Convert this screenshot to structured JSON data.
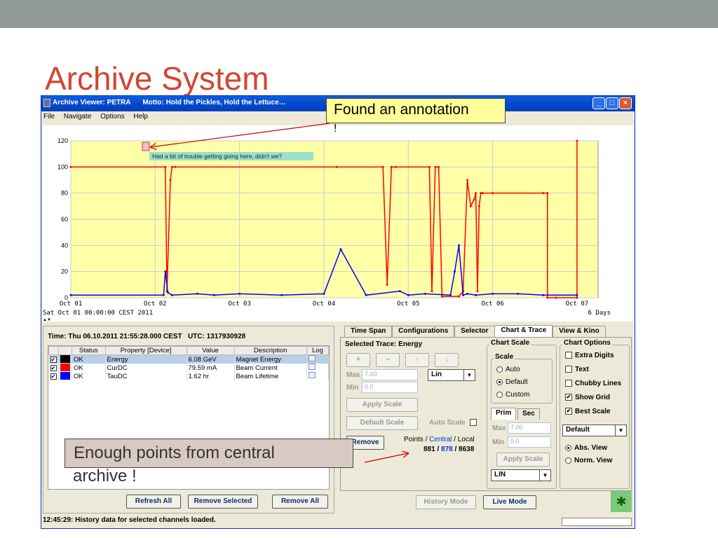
{
  "slide": {
    "title": "Archive System"
  },
  "window": {
    "title": "Archive Viewer: PETRA",
    "motto": "Motto: Hold the Pickles, Hold the Lettuce…",
    "menu": [
      "File",
      "Navigate",
      "Options",
      "Help"
    ]
  },
  "plot": {
    "annotation_marker": "i",
    "annotation_text": "Had a bit of trouble getting going here, didn't we?",
    "start_label": "Sat Oct 01 00:00:00 CEST 2011",
    "span_label": "6 Days",
    "collapse_glyph": "▲▼"
  },
  "chart_data": {
    "type": "line",
    "ylim": [
      0,
      120
    ],
    "yticks": [
      0,
      20,
      40,
      60,
      80,
      100,
      120
    ],
    "xticks": [
      "Oct 01",
      "Oct 02",
      "Oct 03",
      "Oct 04",
      "Oct 05",
      "Oct 06",
      "Oct 07"
    ],
    "grid": true,
    "series": [
      {
        "name": "Energy",
        "color": "#ff0000",
        "x": [
          0,
          1.12,
          1.14,
          1.18,
          1.2,
          1.24,
          3.15,
          3.7,
          3.75,
          3.8,
          3.85,
          4.25,
          4.28,
          4.32,
          4.36,
          4.4,
          4.6,
          4.65,
          4.7,
          4.74,
          4.78,
          4.8,
          4.82,
          4.84,
          4.86,
          4.88,
          5.0,
          5.6,
          5.65,
          5.65,
          5.75,
          6.0
        ],
        "y": [
          100,
          100,
          5,
          90,
          100,
          100,
          100,
          100,
          10,
          100,
          100,
          100,
          5,
          100,
          100,
          1,
          1,
          5,
          90,
          70,
          75,
          80,
          5,
          70,
          80,
          80,
          80,
          80,
          80,
          0,
          0,
          0
        ]
      },
      {
        "name": "CurDC",
        "color": "#ff0000",
        "x": [
          6.0,
          6.0
        ],
        "y": [
          0,
          120
        ]
      },
      {
        "name": "TauDC",
        "color": "#0000ff",
        "x": [
          0,
          1.1,
          1.12,
          1.15,
          1.2,
          1.5,
          1.7,
          2.0,
          2.5,
          3.0,
          3.2,
          3.5,
          3.9,
          4.0,
          4.2,
          4.5,
          4.55,
          4.6,
          4.65,
          4.7,
          4.8,
          5.0,
          5.3,
          5.6,
          6.0
        ],
        "y": [
          2,
          2,
          20,
          4,
          2,
          3,
          2,
          3,
          2,
          3,
          37,
          2,
          5,
          2,
          3,
          2,
          20,
          40,
          2,
          3,
          2,
          3,
          3,
          2,
          2
        ]
      }
    ]
  },
  "info": {
    "time": "Time: Thu 06.10.2011 21:55:28.000 CEST",
    "utc": "UTC: 1317930928"
  },
  "table": {
    "headers": [
      "Status",
      "Property [Device]",
      "Value",
      "Description",
      "Log"
    ],
    "rows": [
      {
        "checked": "✔",
        "color": "#000000",
        "status": "OK",
        "property": "Energy",
        "value": "6.08 GeV",
        "description": "Magnet Energy"
      },
      {
        "checked": "✔",
        "color": "#ff0000",
        "status": "OK",
        "property": "CurDC",
        "value": "79.59 mA",
        "description": "Beam Current"
      },
      {
        "checked": "✔",
        "color": "#0000ff",
        "status": "OK",
        "property": "TauDC",
        "value": "1.62 hr",
        "description": "Beam Lifetime"
      }
    ]
  },
  "buttons": {
    "refresh_all": "Refresh All",
    "remove_selected": "Remove Selected",
    "remove_all": "Remove All",
    "history_mode": "History Mode",
    "live_mode": "Live Mode",
    "remove": "Remove"
  },
  "status": {
    "message": "12:45:29: History data for selected channels loaded."
  },
  "tabs": [
    "Time Span",
    "Configurations",
    "Selector",
    "Chart & Trace",
    "View & Kino"
  ],
  "trace": {
    "selected": "Selected Trace: Energy",
    "plus": "+",
    "minus": "−",
    "up": "↑",
    "down": "↓",
    "max_label": "Max",
    "max_value": "7.00",
    "min_label": "Min",
    "min_value": "0.0",
    "scale_type": "Lin",
    "apply_scale": "Apply Scale",
    "default_scale": "Default Scale",
    "auto_scale": "Auto Scale",
    "points_label": "Points / ",
    "central_word": "Central",
    "local_word": " / Local",
    "points_a": "881 / ",
    "points_b": "878",
    "points_c": " / 8638"
  },
  "chart_scale": {
    "title": "Chart Scale",
    "scale_group": "Scale",
    "options": [
      "Auto",
      "Default",
      "Custom"
    ],
    "selected": "Default",
    "subtabs": [
      "Prim",
      "Sec"
    ],
    "max_label": "Max",
    "max_value": "7.00",
    "min_label": "Min",
    "min_value": "0.0",
    "apply": "Apply Scale",
    "mode": "LIN"
  },
  "chart_options": {
    "title": "Chart Options",
    "items": [
      {
        "label": "Extra Digits",
        "checked": false
      },
      {
        "label": "Text",
        "checked": false
      },
      {
        "label": "Chubby Lines",
        "checked": false
      },
      {
        "label": "Show Grid",
        "checked": true
      },
      {
        "label": "Best Scale",
        "checked": true
      }
    ],
    "preset": "Default",
    "views": [
      "Abs. View",
      "Norm. View"
    ],
    "view_selected": "Abs. View"
  },
  "annotations": {
    "found": "Found an annotation",
    "found_tail": "!",
    "points_line1": "Enough points from central",
    "points_line2": "archive !"
  }
}
